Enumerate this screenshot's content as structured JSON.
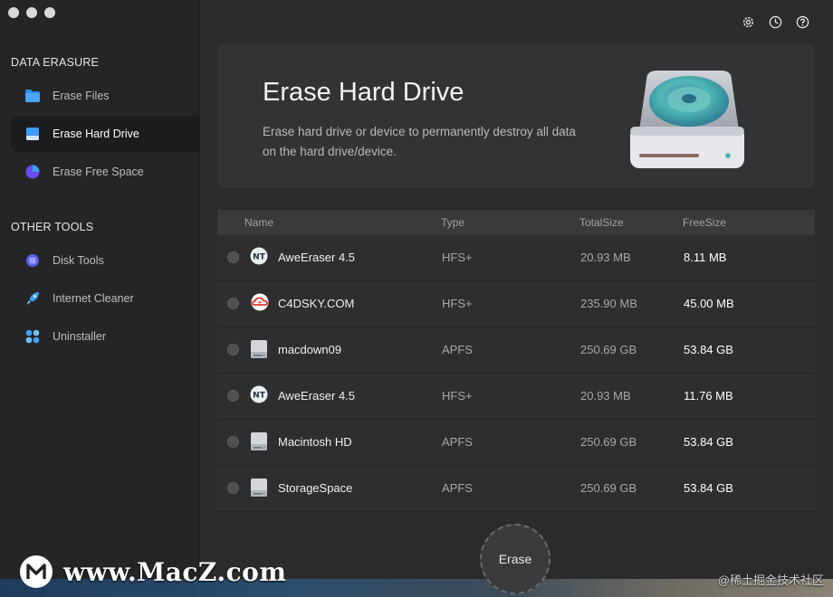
{
  "sidebar": {
    "sections": [
      {
        "title": "DATA ERASURE"
      },
      {
        "title": "OTHER TOOLS"
      }
    ],
    "items": [
      {
        "label": "Erase Files",
        "icon": "folder-icon"
      },
      {
        "label": "Erase Hard Drive",
        "icon": "hard-drive-icon",
        "active": true
      },
      {
        "label": "Erase Free Space",
        "icon": "pie-chart-icon"
      },
      {
        "label": "Disk Tools",
        "icon": "cpu-icon"
      },
      {
        "label": "Internet Cleaner",
        "icon": "rocket-icon"
      },
      {
        "label": "Uninstaller",
        "icon": "apps-grid-icon"
      }
    ]
  },
  "toolbar": {
    "icons": [
      "gear-icon",
      "history-clock-icon",
      "help-icon"
    ]
  },
  "banner": {
    "title": "Erase Hard Drive",
    "description": "Erase hard drive or device to permanently destroy all data on the hard drive/device."
  },
  "table": {
    "headers": {
      "name": "Name",
      "type": "Type",
      "total": "TotalSize",
      "free": "FreeSize"
    },
    "rows": [
      {
        "name": "AweEraser 4.5",
        "type": "HFS+",
        "total": "20.93 MB",
        "free": "8.11 MB",
        "icon": "app-disk-icon"
      },
      {
        "name": "C4DSKY.COM",
        "type": "HFS+",
        "total": "235.90 MB",
        "free": "45.00 MB",
        "icon": "creative-cloud-icon"
      },
      {
        "name": "macdown09",
        "type": "APFS",
        "total": "250.69 GB",
        "free": "53.84 GB",
        "icon": "drive-icon"
      },
      {
        "name": "AweEraser 4.5",
        "type": "HFS+",
        "total": "20.93 MB",
        "free": "11.76 MB",
        "icon": "app-disk-icon"
      },
      {
        "name": "Macintosh HD",
        "type": "APFS",
        "total": "250.69 GB",
        "free": "53.84 GB",
        "icon": "drive-icon"
      },
      {
        "name": "StorageSpace",
        "type": "APFS",
        "total": "250.69 GB",
        "free": "53.84 GB",
        "icon": "drive-icon"
      }
    ]
  },
  "erase_button": {
    "label": "Erase"
  },
  "watermark": {
    "site": "www.MacZ.com",
    "credit": "@稀土掘金技术社区"
  },
  "colors": {
    "accent_blue": "#2b8ff5",
    "hd_teal": "#4fb8b5",
    "cc_red": "#e0332f"
  }
}
